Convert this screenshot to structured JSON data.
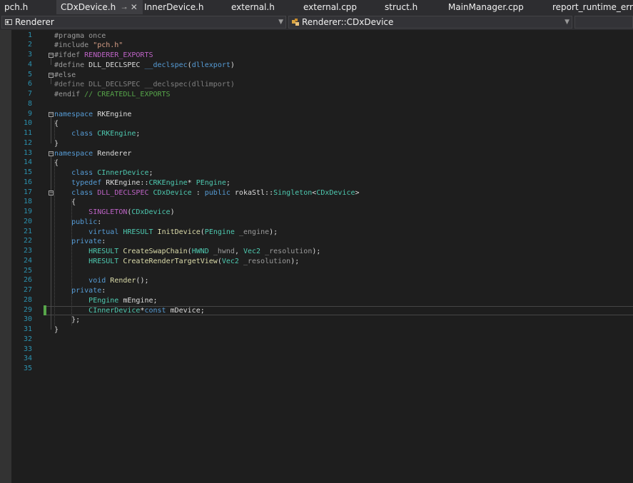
{
  "tabs": [
    {
      "label": "pch.h",
      "active": false
    },
    {
      "label": "CDxDevice.h",
      "active": true
    },
    {
      "label": "InnerDevice.h",
      "active": false
    },
    {
      "label": "external.h",
      "active": false
    },
    {
      "label": "external.cpp",
      "active": false
    },
    {
      "label": "struct.h",
      "active": false
    },
    {
      "label": "MainManager.cpp",
      "active": false
    },
    {
      "label": "report_runtime_error.",
      "active": false
    }
  ],
  "navbar": {
    "project_combo": "Renderer",
    "scope_combo": "Renderer::CDxDevice"
  },
  "editor": {
    "current_line": 29,
    "line_numbers": [
      "1",
      "2",
      "3",
      "4",
      "5",
      "6",
      "7",
      "8",
      "9",
      "10",
      "11",
      "12",
      "13",
      "14",
      "15",
      "16",
      "17",
      "18",
      "19",
      "20",
      "21",
      "22",
      "23",
      "24",
      "25",
      "26",
      "27",
      "28",
      "29",
      "30",
      "31",
      "32",
      "33",
      "34",
      "35"
    ],
    "lines": [
      [
        [
          "pp",
          "#pragma once"
        ]
      ],
      [
        [
          "pp",
          "#include "
        ],
        [
          "st",
          "\"pch.h\""
        ]
      ],
      [
        [
          "pp",
          "#ifdef "
        ],
        [
          "mc",
          "RENDERER_EXPORTS"
        ]
      ],
      [
        [
          "pp",
          "#define "
        ],
        [
          "ns",
          "DLL_DECLSPEC "
        ],
        [
          "kw",
          "__declspec"
        ],
        [
          "ns",
          "("
        ],
        [
          "kw",
          "dllexport"
        ],
        [
          "ns",
          ")"
        ]
      ],
      [
        [
          "pp",
          "#else"
        ]
      ],
      [
        [
          "gr",
          "#define "
        ],
        [
          "gr",
          "DLL_DECLSPEC "
        ],
        [
          "gr",
          "__declspec(dllimport)"
        ]
      ],
      [
        [
          "pp",
          "#endif "
        ],
        [
          "cm",
          "// CREATEDLL_EXPORTS"
        ]
      ],
      [],
      [
        [
          "kw",
          "namespace"
        ],
        [
          "ns",
          " RKEngine"
        ]
      ],
      [
        [
          "ns",
          "{"
        ]
      ],
      [
        [
          "ns",
          "    "
        ],
        [
          "kw",
          "class"
        ],
        [
          "ns",
          " "
        ],
        [
          "ty",
          "CRKEngine"
        ],
        [
          "ns",
          ";"
        ]
      ],
      [
        [
          "ns",
          "}"
        ]
      ],
      [
        [
          "kw",
          "namespace"
        ],
        [
          "ns",
          " Renderer"
        ]
      ],
      [
        [
          "ns",
          "{"
        ]
      ],
      [
        [
          "ns",
          "    "
        ],
        [
          "kw",
          "class"
        ],
        [
          "ns",
          " "
        ],
        [
          "ty",
          "CInnerDevice"
        ],
        [
          "ns",
          ";"
        ]
      ],
      [
        [
          "ns",
          "    "
        ],
        [
          "kw",
          "typedef"
        ],
        [
          "ns",
          " RKEngine::"
        ],
        [
          "ty",
          "CRKEngine"
        ],
        [
          "ns",
          "* "
        ],
        [
          "ty",
          "PEngine"
        ],
        [
          "ns",
          ";"
        ]
      ],
      [
        [
          "ns",
          "    "
        ],
        [
          "kw",
          "class"
        ],
        [
          "ns",
          " "
        ],
        [
          "mc",
          "DLL_DECLSPEC"
        ],
        [
          "ns",
          " "
        ],
        [
          "ty",
          "CDxDevice"
        ],
        [
          "ns",
          " : "
        ],
        [
          "kw",
          "public"
        ],
        [
          "ns",
          " rokaStl::"
        ],
        [
          "ty",
          "Singleton"
        ],
        [
          "ns",
          "<"
        ],
        [
          "ty",
          "CDxDevice"
        ],
        [
          "ns",
          ">"
        ]
      ],
      [
        [
          "ns",
          "    {"
        ]
      ],
      [
        [
          "ns",
          "        "
        ],
        [
          "mc",
          "SINGLETON"
        ],
        [
          "ns",
          "("
        ],
        [
          "ty",
          "CDxDevice"
        ],
        [
          "ns",
          ")"
        ]
      ],
      [
        [
          "ns",
          "    "
        ],
        [
          "kw",
          "public"
        ],
        [
          "ns",
          ":"
        ]
      ],
      [
        [
          "ns",
          "        "
        ],
        [
          "kw",
          "virtual"
        ],
        [
          "ns",
          " "
        ],
        [
          "ty",
          "HRESULT"
        ],
        [
          "ns",
          " "
        ],
        [
          "fn",
          "InitDevice"
        ],
        [
          "ns",
          "("
        ],
        [
          "ty",
          "PEngine"
        ],
        [
          "ns",
          " "
        ],
        [
          "pa",
          "_engine"
        ],
        [
          "ns",
          ");"
        ]
      ],
      [
        [
          "ns",
          "    "
        ],
        [
          "kw",
          "private"
        ],
        [
          "ns",
          ":"
        ]
      ],
      [
        [
          "ns",
          "        "
        ],
        [
          "ty",
          "HRESULT"
        ],
        [
          "ns",
          " "
        ],
        [
          "fn",
          "CreateSwapChain"
        ],
        [
          "ns",
          "("
        ],
        [
          "ty",
          "HWND"
        ],
        [
          "ns",
          " "
        ],
        [
          "pa",
          "_hwnd"
        ],
        [
          "ns",
          ", "
        ],
        [
          "ty",
          "Vec2"
        ],
        [
          "ns",
          " "
        ],
        [
          "pa",
          "_resolution"
        ],
        [
          "ns",
          ");"
        ]
      ],
      [
        [
          "ns",
          "        "
        ],
        [
          "ty",
          "HRESULT"
        ],
        [
          "ns",
          " "
        ],
        [
          "fn",
          "CreateRenderTargetView"
        ],
        [
          "ns",
          "("
        ],
        [
          "ty",
          "Vec2"
        ],
        [
          "ns",
          " "
        ],
        [
          "pa",
          "_resolution"
        ],
        [
          "ns",
          ");"
        ]
      ],
      [],
      [
        [
          "ns",
          "        "
        ],
        [
          "kw",
          "void"
        ],
        [
          "ns",
          " "
        ],
        [
          "fn",
          "Render"
        ],
        [
          "ns",
          "();"
        ]
      ],
      [
        [
          "ns",
          "    "
        ],
        [
          "kw",
          "private"
        ],
        [
          "ns",
          ":"
        ]
      ],
      [
        [
          "ns",
          "        "
        ],
        [
          "ty",
          "PEngine"
        ],
        [
          "ns",
          " mEngine;"
        ]
      ],
      [
        [
          "ns",
          "        "
        ],
        [
          "ty",
          "CInnerDevice"
        ],
        [
          "ns",
          "*"
        ],
        [
          "kw",
          "const"
        ],
        [
          "ns",
          " mDevice;"
        ]
      ],
      [
        [
          "ns",
          "    };"
        ]
      ],
      [
        [
          "ns",
          "}"
        ]
      ],
      [],
      [],
      [],
      []
    ]
  },
  "icons": {
    "close": "close-icon",
    "pin": "pin-icon",
    "dropdown": "chevron-down-icon",
    "class_scope": "class-scope-icon",
    "project": "project-icon"
  },
  "colors": {
    "keyword": "#569cd6",
    "type": "#4ec9b0",
    "macro": "#bd63c5",
    "string": "#d69d85",
    "comment": "#57a64a",
    "line_number": "#2b91af",
    "background": "#1e1e1e"
  }
}
